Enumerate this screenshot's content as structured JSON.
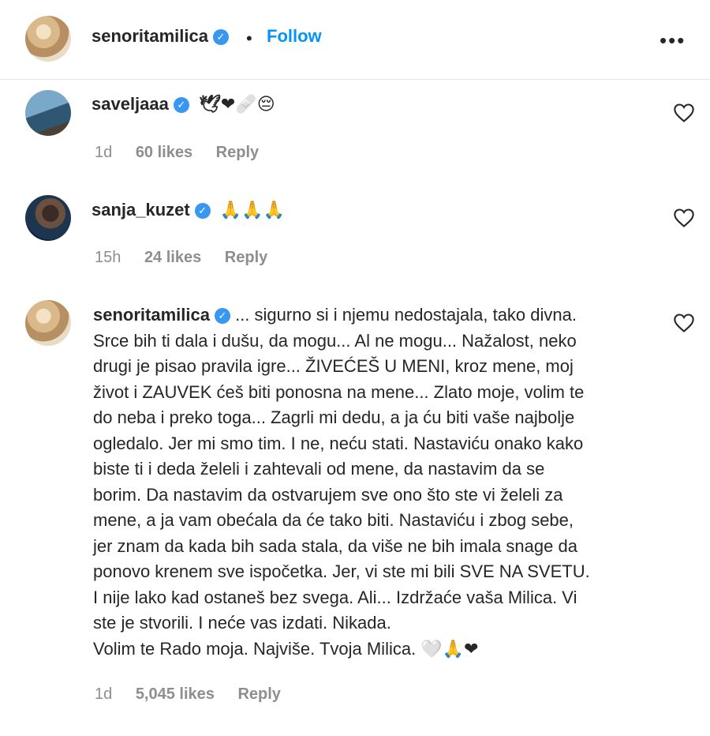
{
  "post_author": {
    "username": "senoritamilica",
    "verified_mark": "✓",
    "separator": "•",
    "follow_label": "Follow",
    "more_label": "•••"
  },
  "comments": [
    {
      "username": "saveljaaa",
      "verified_mark": "✓",
      "text": "🕊❤🩹😔",
      "time": "1d",
      "likes": "60 likes",
      "reply": "Reply"
    },
    {
      "username": "sanja_kuzet",
      "verified_mark": "✓",
      "text": "🙏🙏🙏",
      "time": "15h",
      "likes": "24 likes",
      "reply": "Reply"
    },
    {
      "username": "senoritamilica",
      "verified_mark": "✓",
      "lines": [
        "... sigurno si i njemu nedostajala, tako divna.",
        "Srce bih ti dala i dušu, da mogu... Al ne mogu... Nažalost, neko",
        "drugi je pisao pravila igre... ŽIVEĆEŠ U MENI, kroz mene, moj",
        "život i ZAUVEK ćeš biti ponosna na mene... Zlato moje, volim te",
        "do neba i preko toga... Zagrli mi dedu, a ja ću biti vaše najbolje",
        "ogledalo. Jer mi smo tim. I ne, neću stati. Nastaviću onako kako",
        "biste ti i deda želeli i zahtevali od mene, da nastavim da se",
        "borim. Da nastavim da ostvarujem sve ono što ste vi želeli za",
        "mene, a ja vam obećala da će tako biti. Nastaviću i zbog sebe,",
        "jer znam da kada bih sada stala, da više ne bih imala snage da",
        "ponovo krenem sve ispočetka. Jer, vi ste mi bili SVE NA SVETU.",
        "I nije lako kad ostaneš bez svega. Ali... Izdržaće vaša Milica. Vi",
        "ste je stvorili. I neće vas izdati. Nikada.",
        "Volim te Rado moja. Najviše. Tvoja Milica. 🤍🙏❤"
      ],
      "time": "1d",
      "likes": "5,045 likes",
      "reply": "Reply"
    }
  ],
  "colors": {
    "accent": "#0095f6",
    "verified": "#3897f0",
    "muted": "#8e8e8e",
    "text": "#262626"
  },
  "icons": {
    "like": "heart-outline-icon",
    "verified": "verified-badge-icon",
    "more": "more-options-icon"
  }
}
